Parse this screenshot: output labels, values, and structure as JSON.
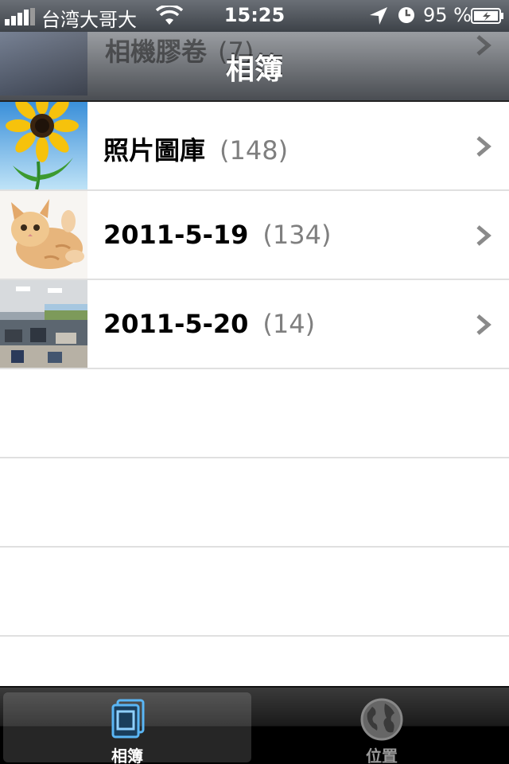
{
  "status_bar": {
    "carrier": "台湾大哥大",
    "time": "15:25",
    "battery_percent": "95 %",
    "icons": [
      "signal-icon",
      "wifi-icon",
      "location-icon",
      "clock-icon",
      "battery-icon"
    ]
  },
  "nav_bar": {
    "title": "相簿",
    "ghost_row": {
      "label": "相機膠卷",
      "count": "(7)"
    }
  },
  "albums": [
    {
      "label": "照片圖庫",
      "count": "(148)",
      "thumb": "sunflower"
    },
    {
      "label": "2011-5-19",
      "count": "(134)",
      "thumb": "kitten"
    },
    {
      "label": "2011-5-20",
      "count": "(14)",
      "thumb": "office"
    }
  ],
  "tab_bar": {
    "tabs": [
      {
        "label": "相簿",
        "icon": "albums-icon",
        "active": true
      },
      {
        "label": "位置",
        "icon": "globe-icon",
        "active": false
      }
    ]
  },
  "colors": {
    "count_gray": "#7f7f7f",
    "chevron_gray": "#8a8a8a",
    "tab_active_blue": "#5ab6f5"
  }
}
